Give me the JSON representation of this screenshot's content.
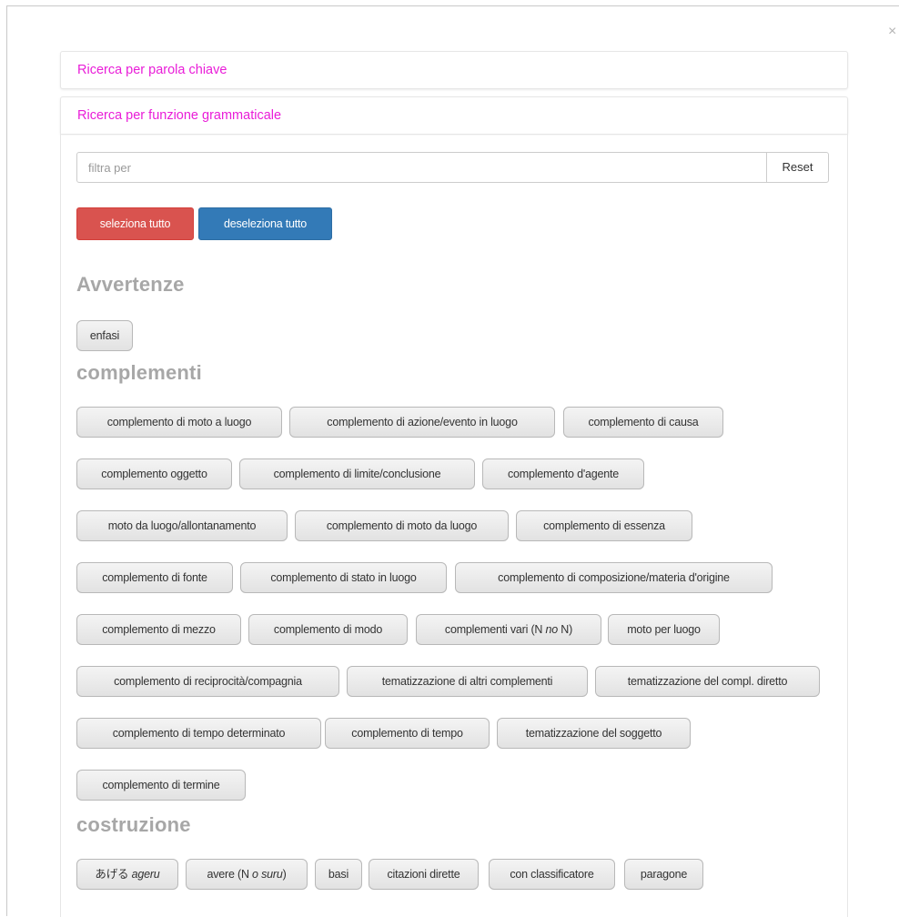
{
  "modal": {
    "close_glyph": "×"
  },
  "panels": {
    "keyword_title": "Ricerca per parola chiave",
    "grammar_title": "Ricerca per funzione grammaticale"
  },
  "filter": {
    "placeholder": "filtra per",
    "value": "",
    "reset_label": "Reset"
  },
  "actions": {
    "select_all": "seleziona tutto",
    "deselect_all": "deseleziona tutto"
  },
  "sections": {
    "avvertenze": {
      "title": "Avvertenze",
      "tags": [
        "enfasi"
      ]
    },
    "complementi": {
      "title": "complementi",
      "tags": [
        "complemento di moto a luogo",
        "complemento di azione/evento in luogo",
        "complemento di causa",
        "complemento oggetto",
        "complemento di limite/conclusione",
        "complemento d'agente",
        "moto da luogo/allontanamento",
        "complemento di moto da luogo",
        "complemento di essenza",
        "complemento di fonte",
        "complemento di stato in luogo",
        "complemento di composizione/materia d'origine",
        "complemento di mezzo",
        "complemento di modo",
        {
          "pre": "complementi vari (N ",
          "em": "no",
          "post": " N)"
        },
        "moto per luogo",
        "complemento di reciprocità/compagnia",
        "tematizzazione di altri complementi",
        "tematizzazione del compl. diretto",
        "complemento di tempo determinato",
        "complemento di tempo",
        "tematizzazione del soggetto",
        "complemento di termine"
      ]
    },
    "costruzione": {
      "title": "costruzione",
      "tags": [
        {
          "pre": "あげる ",
          "em": "ageru",
          "post": ""
        },
        {
          "pre": "avere (N ",
          "em": "o suru",
          "post": ")"
        },
        "basi",
        "citazioni dirette",
        "con classificatore",
        "paragone"
      ]
    }
  }
}
